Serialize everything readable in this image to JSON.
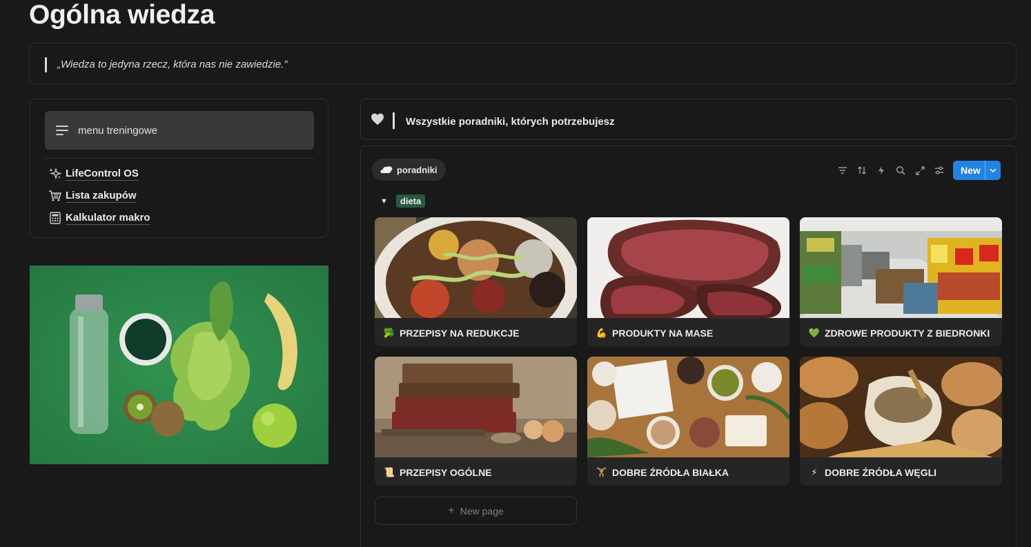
{
  "page": {
    "title": "Ogólna wiedza"
  },
  "quote": {
    "text": "„Wiedza to jedyna rzecz, która nas nie zawiedzie.”"
  },
  "menu": {
    "button_label": "menu treningowe",
    "links": [
      {
        "label": "LifeControl OS",
        "icon": "sparkles-icon"
      },
      {
        "label": "Lista zakupów",
        "icon": "cart-icon"
      },
      {
        "label": "Kalkulator makro",
        "icon": "calculator-icon"
      }
    ]
  },
  "header": {
    "title": "Wszystkie poradniki, których potrzebujesz",
    "icon": "heart-icon"
  },
  "database": {
    "view_tab": "poradniki",
    "new_button": "New",
    "group_label": "dieta",
    "new_page_label": "New page",
    "cards": [
      {
        "title": "PRZEPISY NA REDUKCJE",
        "emoji": "🥦"
      },
      {
        "title": "PRODUKTY NA MASE",
        "emoji": "💪"
      },
      {
        "title": "ZDROWE PRODUKTY Z BIEDRONKI",
        "emoji": "💚"
      },
      {
        "title": "PRZEPISY OGÓLNE",
        "emoji": "📜"
      },
      {
        "title": "DOBRE ŹRÓDŁA BIAŁKA",
        "emoji": "🏋"
      },
      {
        "title": "DOBRE ŹRÓDŁA WĘGLI",
        "emoji": "⚡"
      }
    ]
  },
  "colors": {
    "accent": "#2383e2",
    "tag_green": "#2b593f",
    "background": "#191919"
  }
}
